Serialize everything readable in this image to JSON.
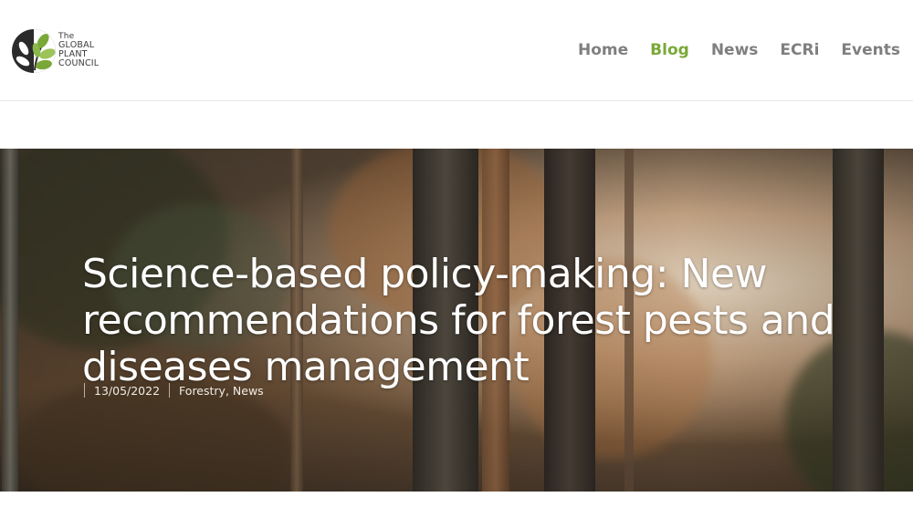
{
  "brand": {
    "line1": "The",
    "line2": "GLOBAL",
    "line3": "PLANT",
    "line4": "COUNCIL",
    "accent_color": "#7aa838"
  },
  "nav": {
    "items": [
      {
        "label": "Home",
        "active": false
      },
      {
        "label": "Blog",
        "active": true
      },
      {
        "label": "News",
        "active": false
      },
      {
        "label": "ECRi",
        "active": false
      },
      {
        "label": "Events",
        "active": false
      }
    ]
  },
  "post": {
    "title": "Science-based policy-making: New recommendations for forest pests and diseases management",
    "date": "13/05/2022",
    "categories": [
      "Forestry",
      "News"
    ],
    "category_separator": ", "
  }
}
